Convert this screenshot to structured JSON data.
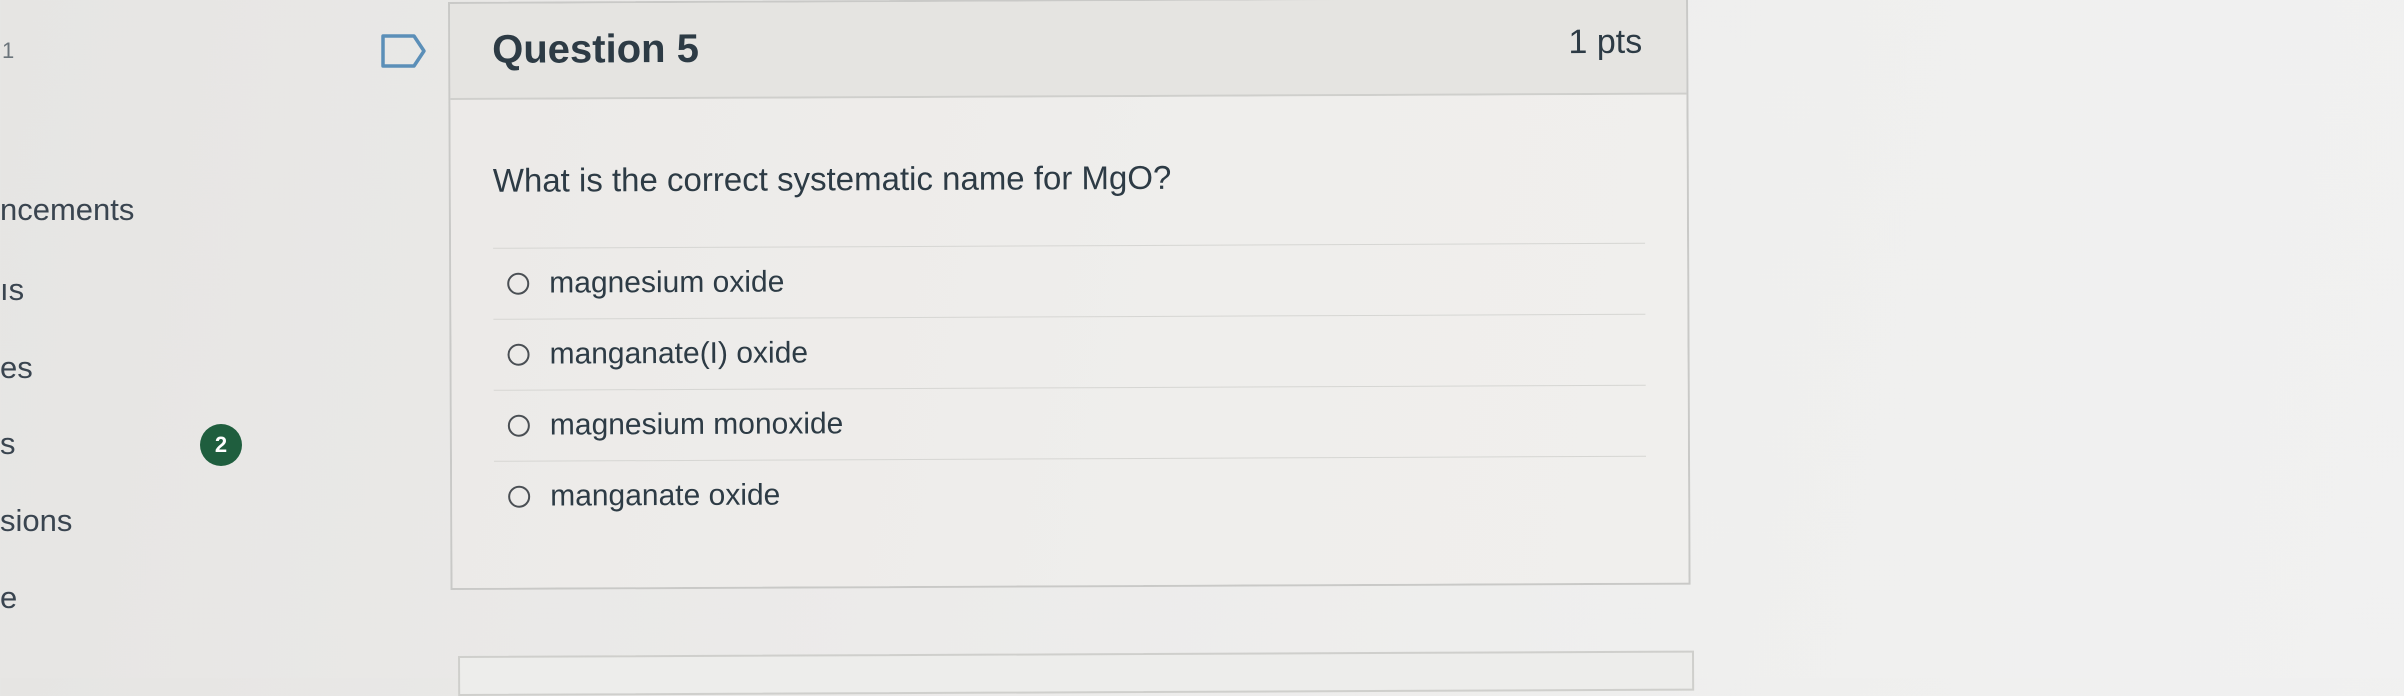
{
  "nav": {
    "top_fragment": "1",
    "items": [
      {
        "label": "ncements"
      },
      {
        "label": "ıs"
      },
      {
        "label": "es"
      },
      {
        "label": "s"
      },
      {
        "label": "sions"
      },
      {
        "label": "e"
      }
    ],
    "badge_count": "2"
  },
  "question": {
    "title": "Question 5",
    "points": "1 pts",
    "text": "What is the correct systematic name for MgO?",
    "answers": [
      {
        "label": "magnesium oxide"
      },
      {
        "label": "manganate(I) oxide"
      },
      {
        "label": "magnesium monoxide"
      },
      {
        "label": "manganate oxide"
      }
    ]
  },
  "icons": {
    "flag": "bookmark-flag-icon",
    "radio": "radio-button-icon"
  },
  "colors": {
    "badge": "#1f5e3e",
    "text": "#2d3b45",
    "border": "#c9c9c7"
  }
}
